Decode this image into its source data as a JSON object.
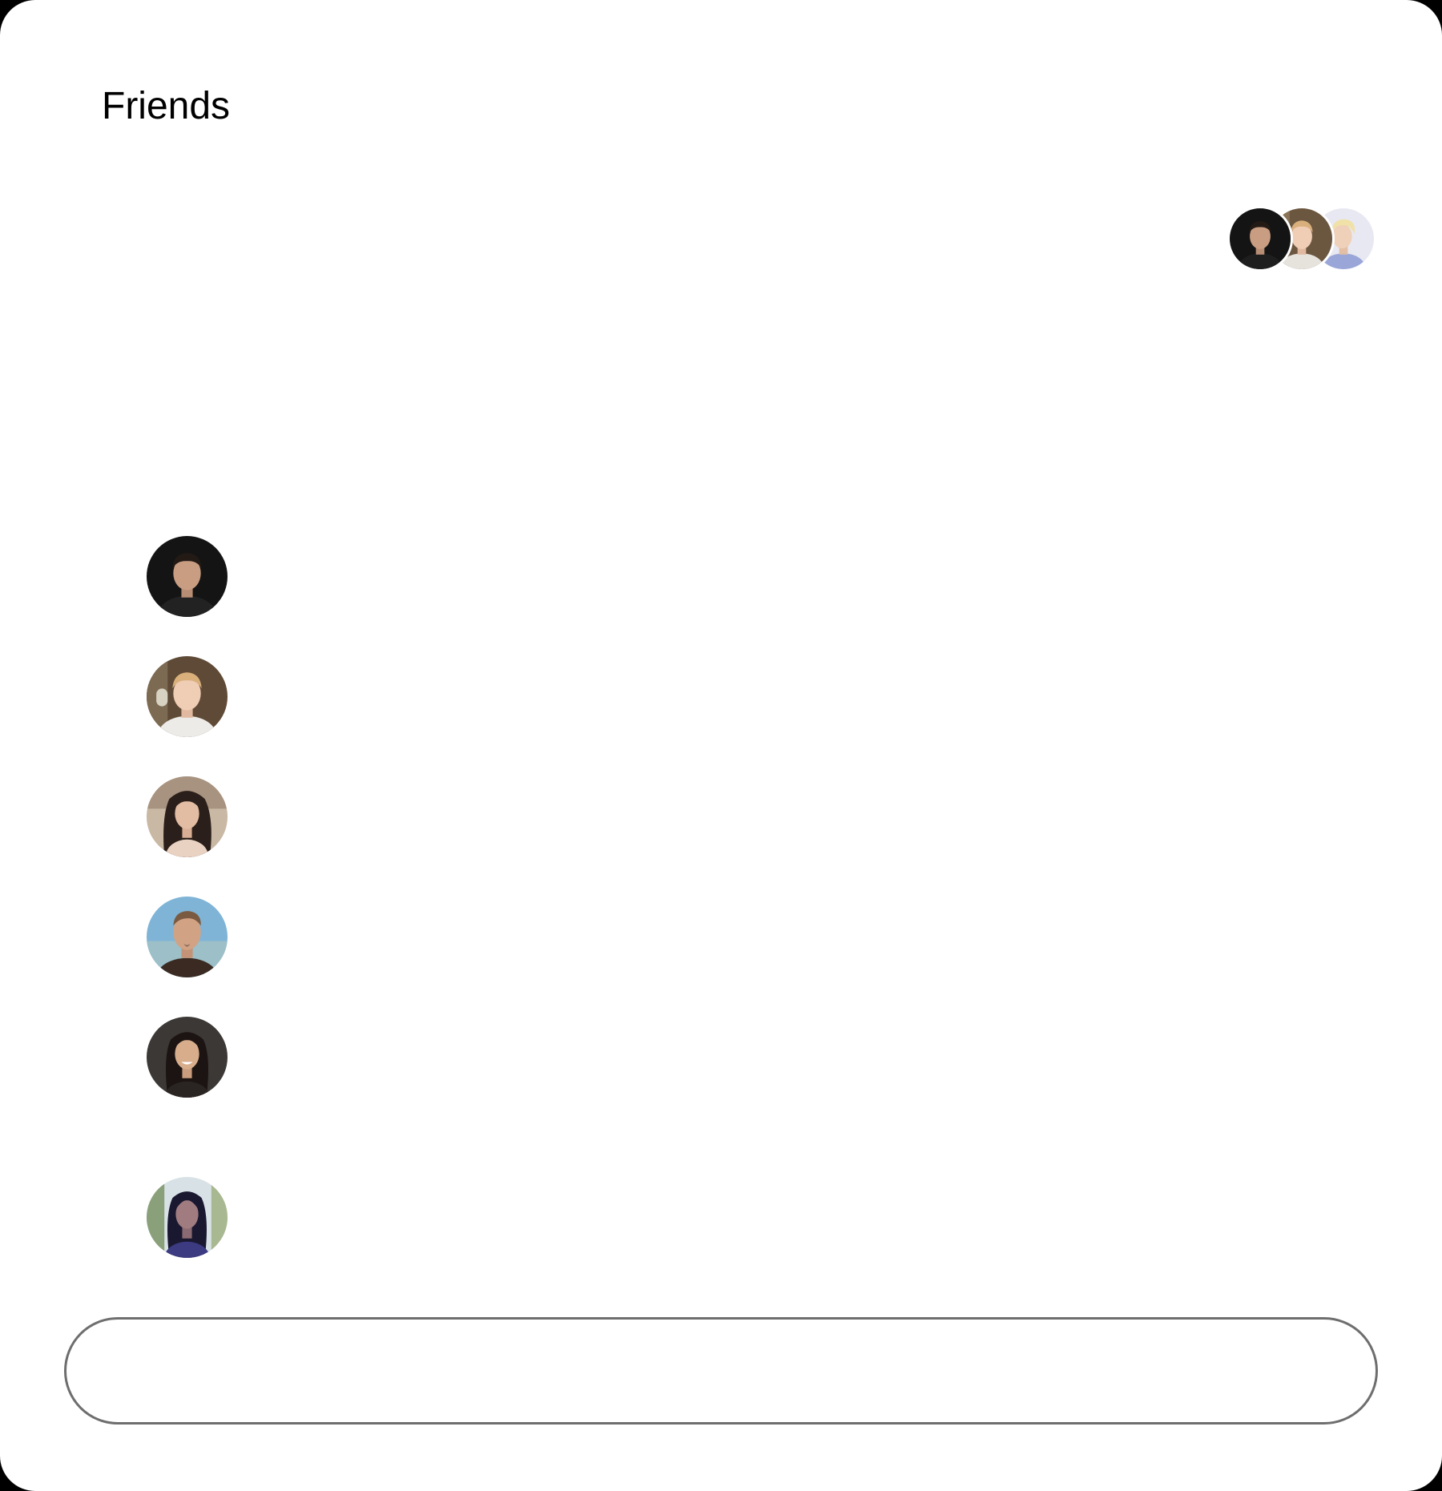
{
  "header": {
    "title": "Friends"
  },
  "avatar_stack": {
    "count": 3
  },
  "friends": {
    "count": 6
  },
  "message_input": {
    "value": "",
    "placeholder": ""
  },
  "colors": {
    "background": "#ffffff",
    "frame": "#000000",
    "input_border": "#6e6e6e",
    "title": "#000000"
  }
}
